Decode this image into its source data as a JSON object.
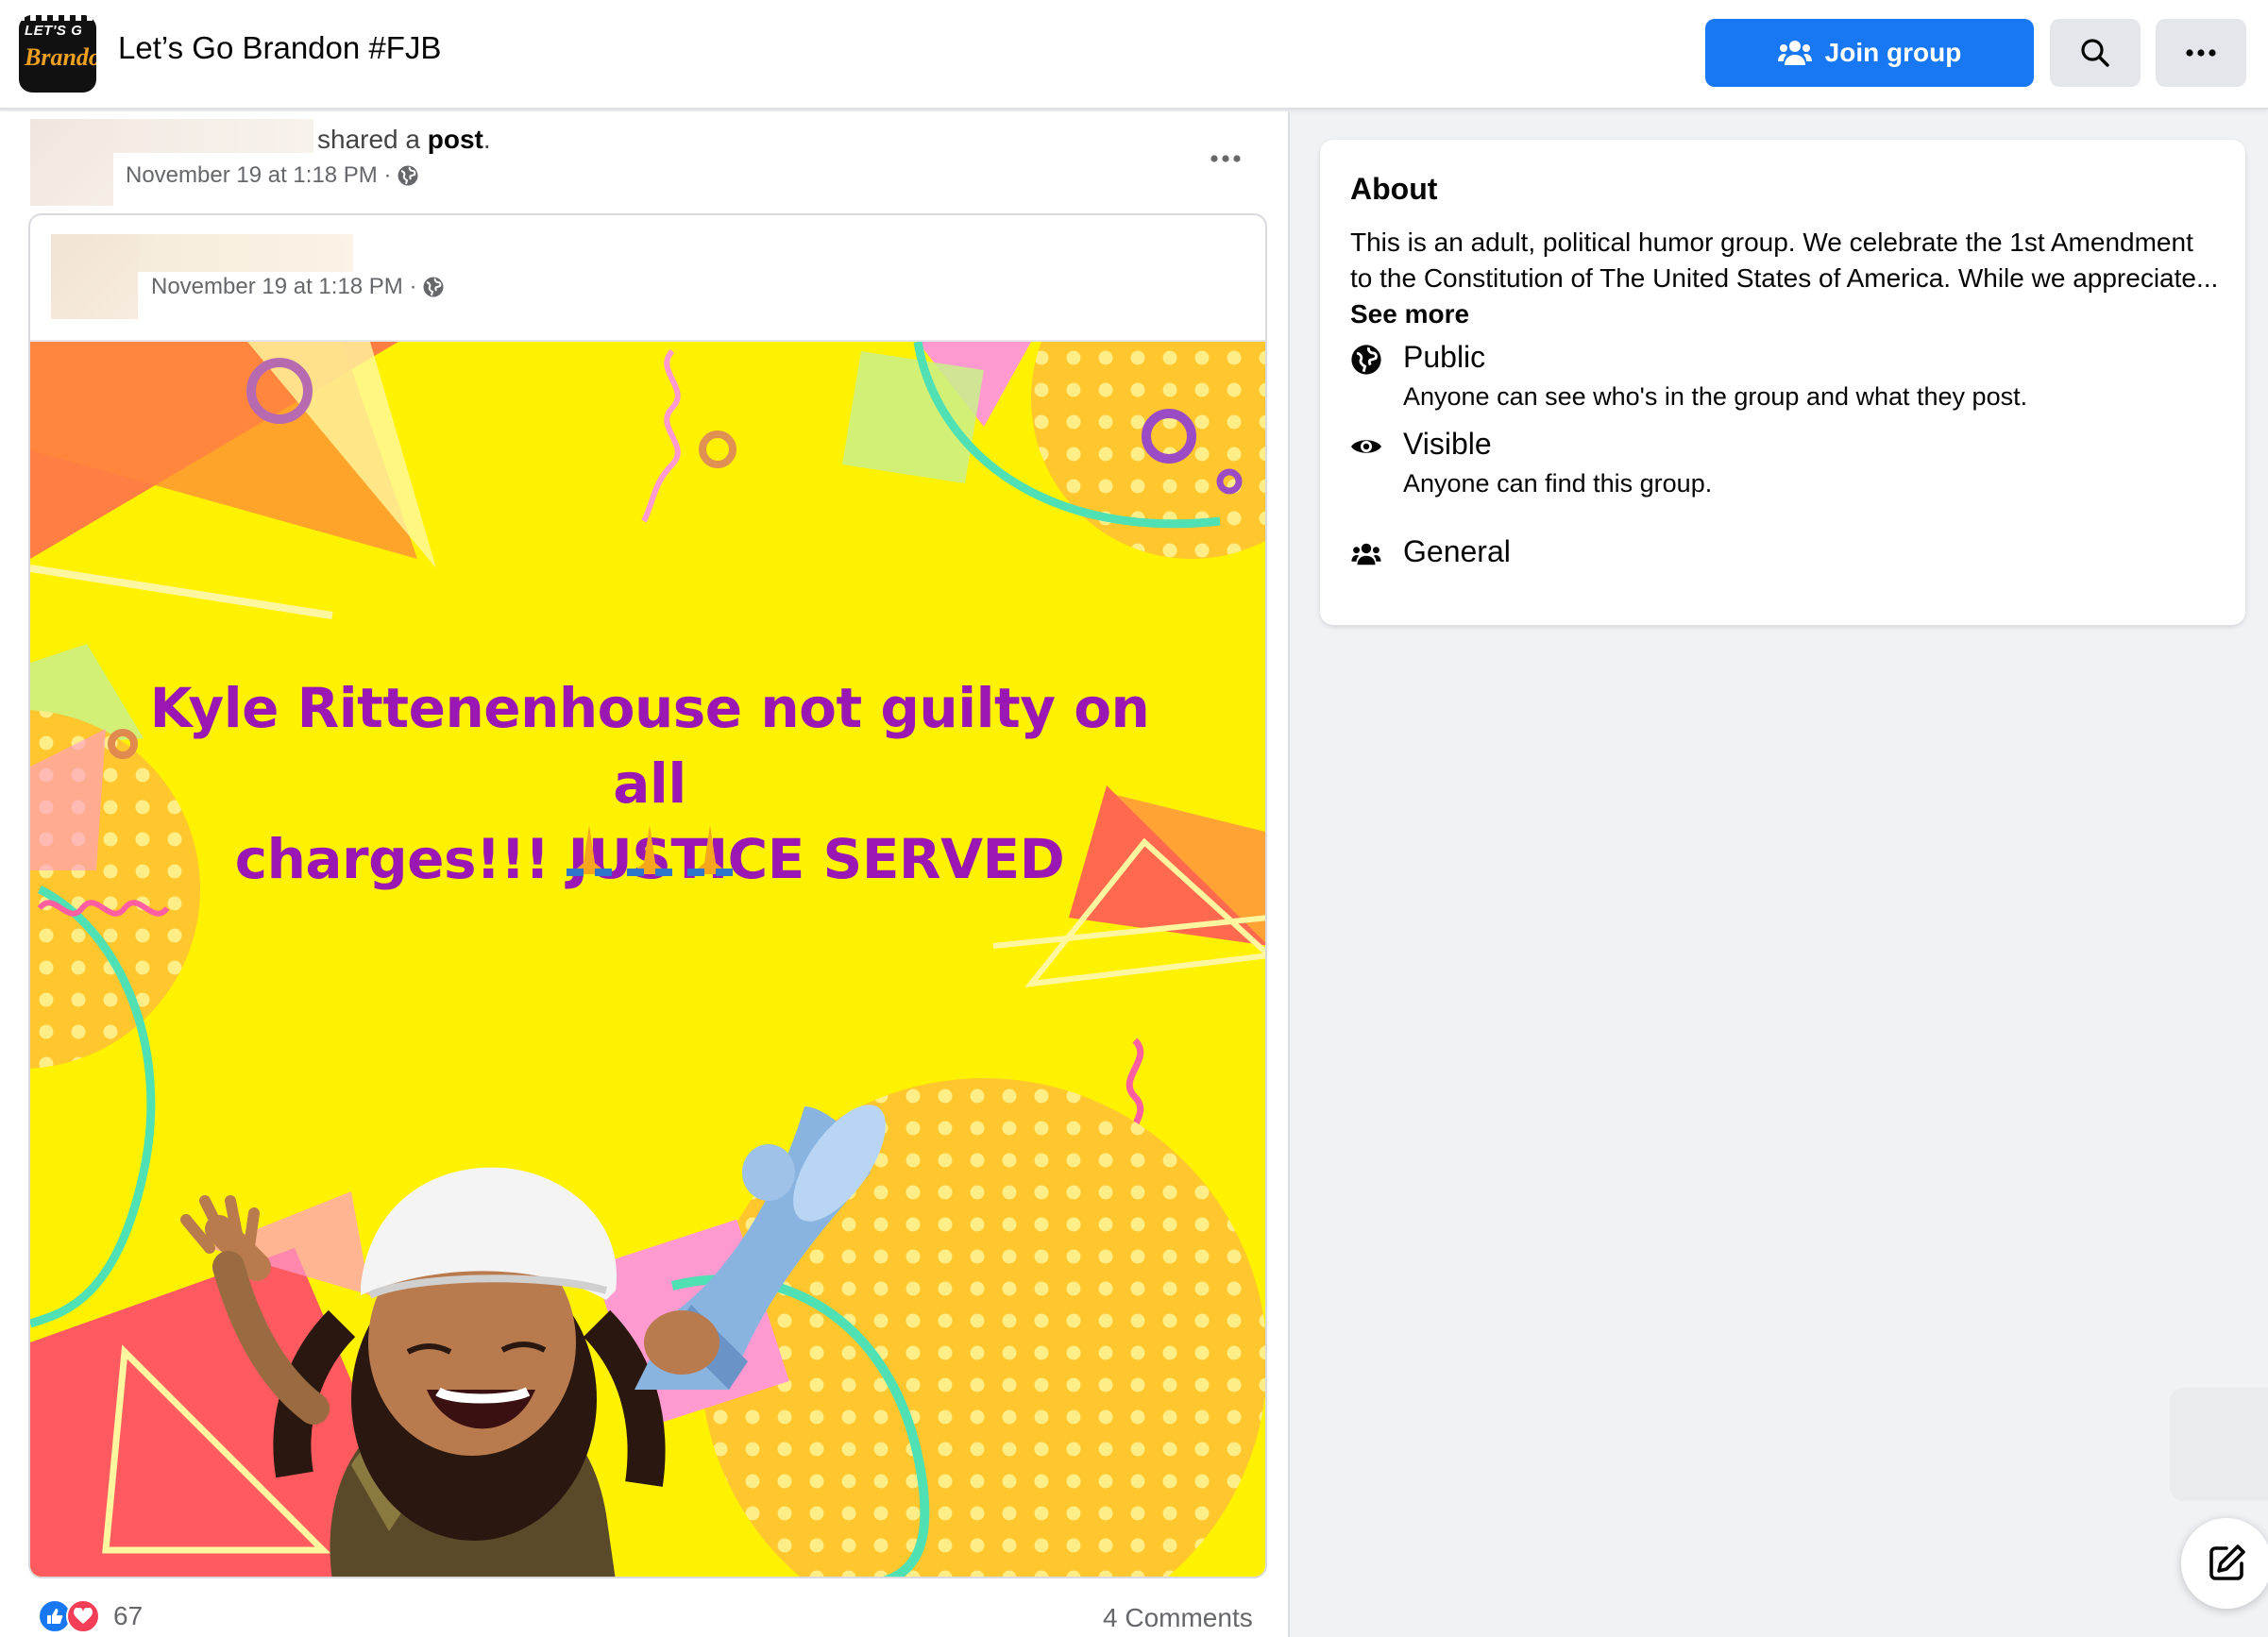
{
  "header": {
    "group_title": "Let’s Go Brandon #FJB",
    "logo_text_top": "LET'S G",
    "logo_text_bottom": "Brando",
    "join_label": "Join group",
    "search_icon": "search-icon",
    "more_icon": "more-horizontal-icon"
  },
  "post": {
    "shared_text": "shared a",
    "shared_link": "post",
    "shared_period": ".",
    "timestamp": "November 19 at 1:18 PM ·",
    "privacy_icon": "globe-icon",
    "inner": {
      "timestamp": "November 19 at 1:18 PM ·"
    },
    "image": {
      "headline_line1": "Kyle Rittenenhouse not guilty on all",
      "headline_line2": "charges!!! JUSTICE SERVED",
      "emoji_icon": "folded-hands-icon"
    },
    "reaction_count": "67",
    "comments": "4 Comments"
  },
  "about": {
    "title": "About",
    "description": "This is an adult, political humor group. We celebrate the 1st Amendment to the Constitution of The United States of America. While we appreciate...",
    "see_more": "See more",
    "public_title": "Public",
    "public_desc": "Anyone can see who's in the group and what they post.",
    "visible_title": "Visible",
    "visible_desc": "Anyone can find this group.",
    "general_title": "General"
  },
  "colors": {
    "primary": "#1877f2",
    "headline": "#9b17b4",
    "image_bg": "#fff200",
    "love": "#f33e58"
  }
}
